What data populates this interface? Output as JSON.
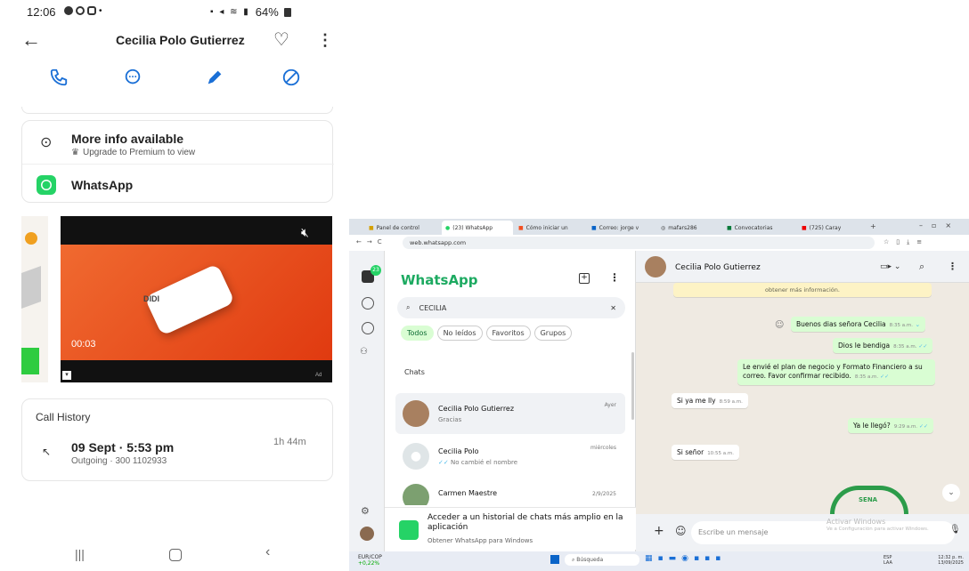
{
  "phone": {
    "status_time": "12:06",
    "status_right": "64%",
    "contact_name": "Cecilia Polo Gutierrez",
    "more_info_title": "More info available",
    "more_info_sub": "Upgrade to Premium to view",
    "whatsapp_label": "WhatsApp",
    "video_time": "00:03",
    "ad_brand": "DIDI",
    "ad_label": "Ad",
    "call_history_title": "Call History",
    "call_date": "09 Sept · 5:53 pm",
    "call_sub": "Outgoing · 300 1102933",
    "call_duration": "1h 44m"
  },
  "browser": {
    "tabs": [
      "Panel de control",
      "(23) WhatsApp",
      "Cómo iniciar un",
      "Correo: jorge v",
      "mafars286",
      "Convocatorias",
      "(725) Caray"
    ],
    "url": "web.whatsapp.com"
  },
  "wa": {
    "badge": "23",
    "title": "WhatsApp",
    "search_value": "CECILIA",
    "filters": [
      "Todos",
      "No leídos",
      "Favoritos",
      "Grupos"
    ],
    "chats_label": "Chats",
    "chats": [
      {
        "name": "Cecilia Polo Gutierrez",
        "preview": "Gracias",
        "time": "Ayer"
      },
      {
        "name": "Cecilia Polo",
        "preview": "No cambié el nombre",
        "time": "miércoles"
      },
      {
        "name": "Carmen Maestre",
        "preview": "",
        "time": "2/9/2025"
      }
    ],
    "promo_title": "Acceder a un historial de chats más amplio en la aplicación",
    "promo_sub": "Obtener WhatsApp para Windows",
    "header_name": "Cecilia Polo Gutierrez",
    "sys_note": "obtener más información.",
    "messages": [
      {
        "text": "Buenos dias señora Cecilia",
        "time": "8:35 a.m."
      },
      {
        "text": "Dios le bendiga",
        "time": "8:35 a.m."
      },
      {
        "text": "Le envié el plan de negocio y Formato Financiero a su correo. Favor confirmar recibido.",
        "time": "8:35 a.m."
      },
      {
        "text": "Si ya me lly",
        "time": "8:59 a.m."
      },
      {
        "text": "Ya le llegó?",
        "time": "9:29 a.m."
      },
      {
        "text": "Si señor",
        "time": "10:55 a.m."
      }
    ],
    "input_placeholder": "Escribe un mensaje",
    "activate_title": "Activar Windows",
    "activate_sub": "Ve a Configuración para activar Windows.",
    "sena": "SENA"
  },
  "taskbar": {
    "fx": "EUR/COP",
    "fx_change": "+0,22%",
    "search": "Búsqueda",
    "lang": "ESP",
    "lang2": "LAA",
    "clock_time": "12:32 p. m.",
    "clock_date": "13/09/2025"
  }
}
